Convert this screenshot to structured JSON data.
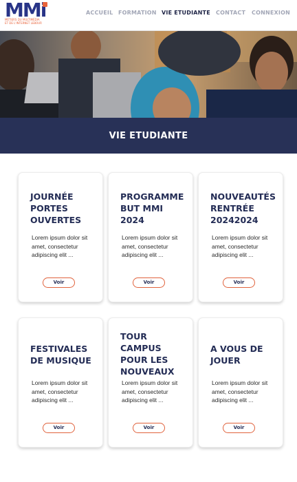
{
  "logo": {
    "mark": "MMi",
    "line1": "MÉTIERS DU MULTIMÉDIA",
    "line2": "ET DE L'INTERNET LEBOUR"
  },
  "nav": {
    "items": [
      {
        "label": "ACCUEIL",
        "active": false
      },
      {
        "label": "FORMATION",
        "active": false
      },
      {
        "label": "VIE ETUDIANTE",
        "active": true
      },
      {
        "label": "CONTACT",
        "active": false
      },
      {
        "label": "CONNEXION",
        "active": false
      }
    ]
  },
  "hero": {
    "title": "VIE ETUDIANTE"
  },
  "cards": [
    {
      "title": "JOURNÉE PORTES OUVERTES",
      "text": "Lorem ipsum dolor sit amet, consectetur adipiscing elit ...",
      "button": "Voir"
    },
    {
      "title": "PROGRAMME BUT MMI 2024",
      "text": "Lorem ipsum dolor sit amet, consectetur adipiscing elit ...",
      "button": "Voir"
    },
    {
      "title": "NOUVEAUTÉS RENTRÉE 20242024",
      "text": "Lorem ipsum dolor sit amet, consectetur adipiscing elit ...",
      "button": "Voir"
    },
    {
      "title": "FESTIVALES DE MUSIQUE",
      "text": "Lorem ipsum dolor sit amet, consectetur adipiscing elit ...",
      "button": "Voir"
    },
    {
      "title": "TOUR CAMPUS POUR LES NOUVEAUX",
      "text": "Lorem ipsum dolor sit amet, consectetur adipiscing elit ...",
      "button": "Voir"
    },
    {
      "title": "A VOUS DE JOUER",
      "text": "Lorem ipsum dolor sit amet, consectetur adipiscing elit ...",
      "button": "Voir"
    }
  ],
  "colors": {
    "brand_blue": "#283487",
    "accent_orange": "#e8643c",
    "banner_navy": "#283157",
    "nav_inactive": "#a3a7b7"
  }
}
